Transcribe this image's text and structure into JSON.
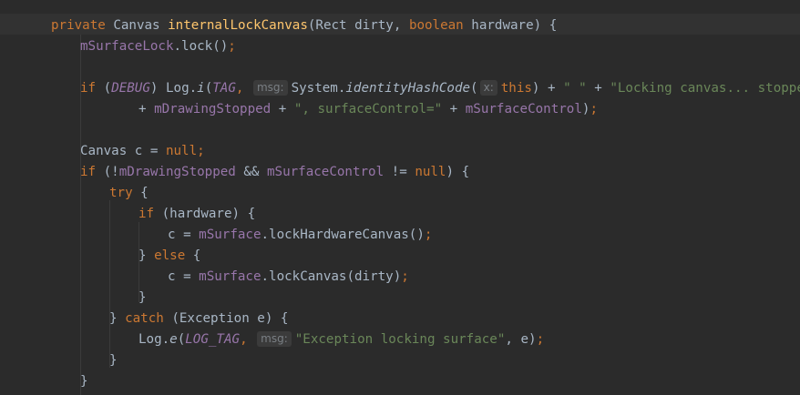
{
  "editor": {
    "language": "java",
    "theme": "darcula",
    "lines": [
      {
        "indent": 0,
        "tokens": [
          {
            "t": "private",
            "c": "kw"
          },
          {
            "t": " Canvas ",
            "c": "pl"
          },
          {
            "t": "internalLockCanvas",
            "c": "fn"
          },
          {
            "t": "(Rect dirty, ",
            "c": "pl"
          },
          {
            "t": "boolean",
            "c": "kw"
          },
          {
            "t": " hardware) {",
            "c": "pl"
          }
        ]
      },
      {
        "indent": 1,
        "tokens": [
          {
            "t": "mSurfaceLock",
            "c": "fld"
          },
          {
            "t": ".lock()",
            "c": "pl"
          },
          {
            "t": ";",
            "c": "kw"
          }
        ]
      },
      {
        "indent": 0,
        "tokens": []
      },
      {
        "indent": 1,
        "tokens": [
          {
            "t": "if",
            "c": "kw"
          },
          {
            "t": " (",
            "c": "pl"
          },
          {
            "t": "DEBUG",
            "c": "cst"
          },
          {
            "t": ") Log.",
            "c": "pl"
          },
          {
            "t": "i",
            "c": "it"
          },
          {
            "t": "(",
            "c": "pl"
          },
          {
            "t": "TAG",
            "c": "cst"
          },
          {
            "t": ",",
            "c": "kw"
          },
          {
            "t": " ",
            "c": "pl"
          },
          {
            "t": "msg:",
            "c": "hint"
          },
          {
            "t": "System.",
            "c": "pl"
          },
          {
            "t": "identityHashCode",
            "c": "it"
          },
          {
            "t": "(",
            "c": "pl"
          },
          {
            "t": "x:",
            "c": "hint"
          },
          {
            "t": "this",
            "c": "kw"
          },
          {
            "t": ") + ",
            "c": "pl"
          },
          {
            "t": "\" \"",
            "c": "str"
          },
          {
            "t": " + ",
            "c": "pl"
          },
          {
            "t": "\"Locking canvas... stopped=\"",
            "c": "str"
          }
        ]
      },
      {
        "indent": 3,
        "tokens": [
          {
            "t": "+ ",
            "c": "pl"
          },
          {
            "t": "mDrawingStopped",
            "c": "fld"
          },
          {
            "t": " + ",
            "c": "pl"
          },
          {
            "t": "\", surfaceControl=\"",
            "c": "str"
          },
          {
            "t": " + ",
            "c": "pl"
          },
          {
            "t": "mSurfaceControl",
            "c": "fld"
          },
          {
            "t": ")",
            "c": "pl"
          },
          {
            "t": ";",
            "c": "kw"
          }
        ]
      },
      {
        "indent": 0,
        "tokens": []
      },
      {
        "indent": 1,
        "tokens": [
          {
            "t": "Canvas c = ",
            "c": "pl"
          },
          {
            "t": "null",
            "c": "kw"
          },
          {
            "t": ";",
            "c": "kw"
          }
        ]
      },
      {
        "indent": 1,
        "tokens": [
          {
            "t": "if",
            "c": "kw"
          },
          {
            "t": " (!",
            "c": "pl"
          },
          {
            "t": "mDrawingStopped",
            "c": "fld"
          },
          {
            "t": " && ",
            "c": "pl"
          },
          {
            "t": "mSurfaceControl",
            "c": "fld"
          },
          {
            "t": " != ",
            "c": "pl"
          },
          {
            "t": "null",
            "c": "kw"
          },
          {
            "t": ") {",
            "c": "pl"
          }
        ]
      },
      {
        "indent": 2,
        "tokens": [
          {
            "t": "try",
            "c": "kw"
          },
          {
            "t": " {",
            "c": "pl"
          }
        ]
      },
      {
        "indent": 3,
        "tokens": [
          {
            "t": "if",
            "c": "kw"
          },
          {
            "t": " (hardware) {",
            "c": "pl"
          }
        ]
      },
      {
        "indent": 4,
        "tokens": [
          {
            "t": "c = ",
            "c": "pl"
          },
          {
            "t": "mSurface",
            "c": "fld"
          },
          {
            "t": ".lockHardwareCanvas()",
            "c": "pl"
          },
          {
            "t": ";",
            "c": "kw"
          }
        ]
      },
      {
        "indent": 3,
        "tokens": [
          {
            "t": "} ",
            "c": "pl"
          },
          {
            "t": "else",
            "c": "kw"
          },
          {
            "t": " {",
            "c": "pl"
          }
        ]
      },
      {
        "indent": 4,
        "tokens": [
          {
            "t": "c = ",
            "c": "pl"
          },
          {
            "t": "mSurface",
            "c": "fld"
          },
          {
            "t": ".lockCanvas(dirty)",
            "c": "pl"
          },
          {
            "t": ";",
            "c": "kw"
          }
        ]
      },
      {
        "indent": 3,
        "tokens": [
          {
            "t": "}",
            "c": "pl"
          }
        ]
      },
      {
        "indent": 2,
        "tokens": [
          {
            "t": "} ",
            "c": "pl"
          },
          {
            "t": "catch",
            "c": "kw"
          },
          {
            "t": " (Exception e) {",
            "c": "pl"
          }
        ]
      },
      {
        "indent": 3,
        "tokens": [
          {
            "t": "Log.",
            "c": "pl"
          },
          {
            "t": "e",
            "c": "it"
          },
          {
            "t": "(",
            "c": "pl"
          },
          {
            "t": "LOG_TAG",
            "c": "cst"
          },
          {
            "t": ",",
            "c": "kw"
          },
          {
            "t": " ",
            "c": "pl"
          },
          {
            "t": "msg:",
            "c": "hint"
          },
          {
            "t": "\"Exception locking surface\"",
            "c": "str"
          },
          {
            "t": ", e)",
            "c": "pl"
          },
          {
            "t": ";",
            "c": "kw"
          }
        ]
      },
      {
        "indent": 2,
        "tokens": [
          {
            "t": "}",
            "c": "pl"
          }
        ]
      },
      {
        "indent": 1,
        "tokens": [
          {
            "t": "}",
            "c": "pl"
          }
        ]
      }
    ]
  },
  "colors": {
    "background": "#2b2b2b",
    "current_line": "#323232",
    "keyword": "#cc7832",
    "method_declaration": "#ffc66d",
    "field": "#9876aa",
    "string": "#6a8759",
    "plain": "#a9b7c6",
    "param_hint_bg": "#3b3b3b",
    "param_hint_fg": "#7a7f84"
  }
}
